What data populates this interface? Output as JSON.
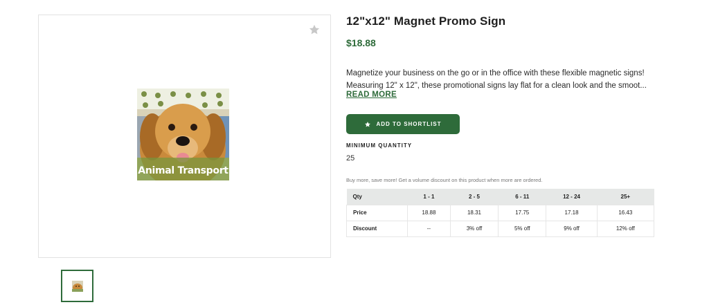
{
  "product": {
    "title": "12\"x12\" Magnet Promo Sign",
    "price": "$18.88",
    "description_lines": [
      "Magnetize your business on the go or in the office with these flexible magnetic signs!",
      "Measuring 12\" x 12\", these promotional signs lay flat for a clean look and the smoot..."
    ],
    "read_more_label": "READ MORE",
    "image_caption": "Animal Transport"
  },
  "actions": {
    "shortlist_label": "ADD TO SHORTLIST"
  },
  "quantity": {
    "min_label": "MINIMUM QUANTITY",
    "min_value": "25"
  },
  "pricing": {
    "note": "Buy more, save more! Get a volume discount on this product when more are ordered.",
    "header": [
      "Qty",
      "1 - 1",
      "2 - 5",
      "6 - 11",
      "12 - 24",
      "25+"
    ],
    "rows": [
      [
        "Price",
        "18.88",
        "18.31",
        "17.75",
        "17.18",
        "16.43"
      ],
      [
        "Discount",
        "--",
        "3% off",
        "5% off",
        "9% off",
        "12% off"
      ]
    ]
  },
  "icons": {
    "favorite": "star-icon",
    "button": "star-icon"
  },
  "colors": {
    "brand_green": "#2e6b3a",
    "table_header": "#e6e8e7"
  }
}
